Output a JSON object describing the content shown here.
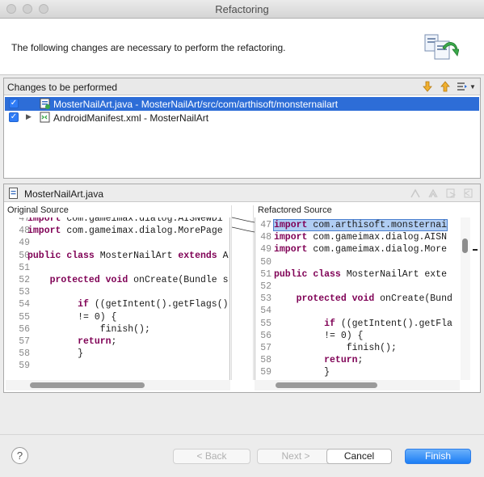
{
  "window": {
    "title": "Refactoring"
  },
  "header": {
    "message": "The following changes are necessary to perform the refactoring."
  },
  "changes": {
    "title": "Changes to be performed",
    "items": [
      {
        "label": "MosterNailArt.java - MosterNailArt/src/com/arthisoft/monsternailart",
        "checked": true,
        "selected": true
      },
      {
        "label": "AndroidManifest.xml - MosterNailArt",
        "checked": true,
        "selected": false
      }
    ]
  },
  "compare": {
    "file": "MosterNailArt.java",
    "original_title": "Original Source",
    "refactored_title": "Refactored Source",
    "original_lines": [
      {
        "n": "47",
        "code": "import com.gameimax.dialog.AISNewDi"
      },
      {
        "n": "48",
        "code": "import com.gameimax.dialog.MorePage"
      },
      {
        "n": "49",
        "code": ""
      },
      {
        "n": "50",
        "code": "public class MosterNailArt extends A"
      },
      {
        "n": "51",
        "code": ""
      },
      {
        "n": "52",
        "code": "    protected void onCreate(Bundle s"
      },
      {
        "n": "53",
        "code": ""
      },
      {
        "n": "54",
        "code": "         if ((getIntent().getFlags()"
      },
      {
        "n": "55",
        "code": "         != 0) {"
      },
      {
        "n": "56",
        "code": "             finish();"
      },
      {
        "n": "57",
        "code": "         return;"
      },
      {
        "n": "58",
        "code": "         }"
      },
      {
        "n": "59",
        "code": ""
      }
    ],
    "refactored_lines": [
      {
        "n": "47",
        "code": "import com.arthisoft.monsternai"
      },
      {
        "n": "48",
        "code": "import com.gameimax.dialog.AISN"
      },
      {
        "n": "49",
        "code": "import com.gameimax.dialog.More"
      },
      {
        "n": "50",
        "code": ""
      },
      {
        "n": "51",
        "code": "public class MosterNailArt exte"
      },
      {
        "n": "52",
        "code": ""
      },
      {
        "n": "53",
        "code": "    protected void onCreate(Bund"
      },
      {
        "n": "54",
        "code": ""
      },
      {
        "n": "55",
        "code": "         if ((getIntent().getFla"
      },
      {
        "n": "56",
        "code": "         != 0) {"
      },
      {
        "n": "57",
        "code": "             finish();"
      },
      {
        "n": "58",
        "code": "         return;"
      },
      {
        "n": "59",
        "code": "         }"
      }
    ]
  },
  "buttons": {
    "help": "?",
    "back": "< Back",
    "next": "Next >",
    "cancel": "Cancel",
    "finish": "Finish"
  },
  "colors": {
    "accent": "#2d6dd7",
    "keyword": "#7f0055",
    "highlight": "#b0cdf3"
  }
}
